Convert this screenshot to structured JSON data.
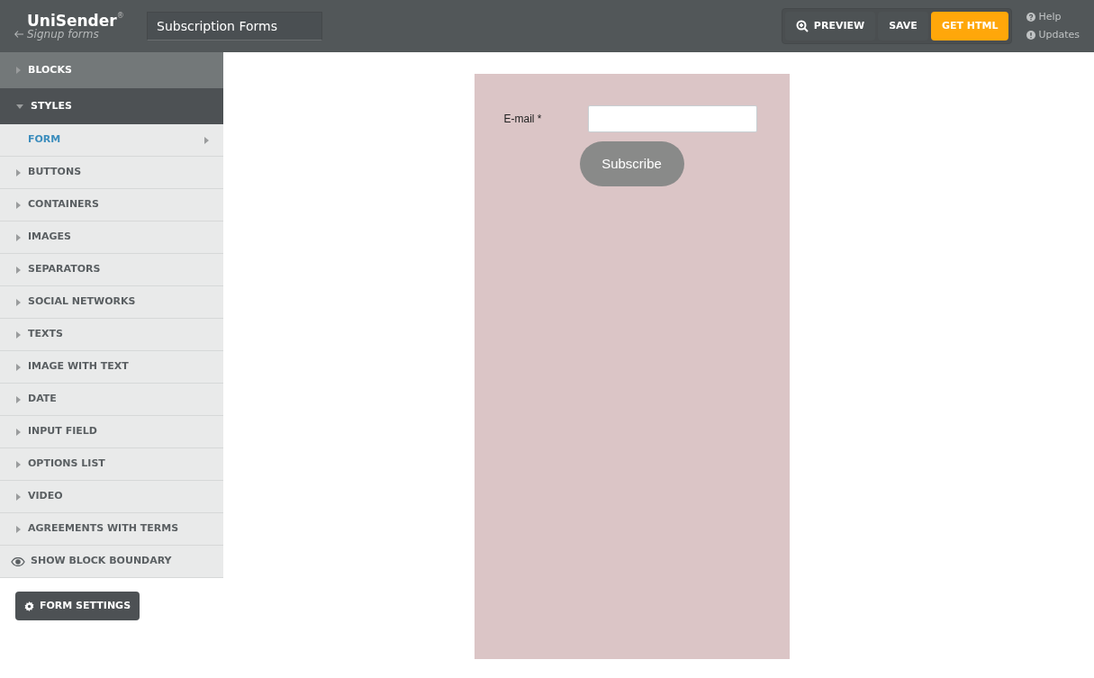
{
  "header": {
    "logo": "UniSender",
    "logo_mark": "®",
    "back_link": "Signup forms",
    "title_field": "Subscription Forms",
    "buttons": [
      {
        "kind": "preview",
        "label": "PREVIEW"
      },
      {
        "kind": "plain",
        "label": "SAVE"
      },
      {
        "kind": "primary",
        "label": "GET HTML"
      }
    ],
    "links": [
      {
        "kind": "help",
        "label": "Help"
      },
      {
        "kind": "info",
        "label": "Updates"
      }
    ]
  },
  "sidebar": {
    "sections": [
      {
        "label": "BLOCKS",
        "expanded": false
      },
      {
        "label": "STYLES",
        "expanded": true,
        "children": [
          {
            "label": "FORM",
            "selected": true
          },
          {
            "label": "BUTTONS",
            "selected": false
          },
          {
            "label": "CONTAINERS",
            "selected": false
          },
          {
            "label": "IMAGES",
            "selected": false
          },
          {
            "label": "SEPARATORS",
            "selected": false
          },
          {
            "label": "SOCIAL NETWORKS",
            "selected": false
          },
          {
            "label": "TEXTS",
            "selected": false
          },
          {
            "label": "IMAGE WITH TEXT",
            "selected": false
          },
          {
            "label": "DATE",
            "selected": false
          },
          {
            "label": "INPUT FIELD",
            "selected": false
          },
          {
            "label": "OPTIONS LIST",
            "selected": false
          },
          {
            "label": "VIDEO",
            "selected": false
          },
          {
            "label": "AGREEMENTS WITH TERMS",
            "selected": false
          }
        ]
      }
    ],
    "boundary_toggle": "SHOW BLOCK BOUNDARY",
    "settings_button": "FORM SETTINGS"
  },
  "form": {
    "field_label": "E-mail *",
    "submit_button": "Subscribe"
  }
}
